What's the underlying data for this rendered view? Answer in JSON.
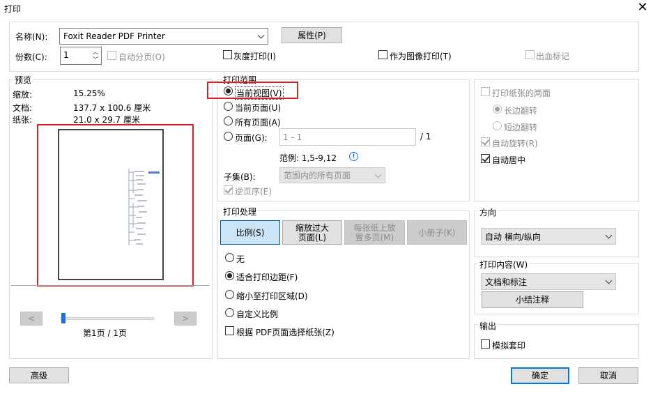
{
  "window": {
    "title": "打印"
  },
  "printer": {
    "name_label": "名称(N):",
    "name_value": "Foxit Reader PDF Printer",
    "properties_button": "属性(P)"
  },
  "copies": {
    "label": "份数(C):",
    "value": "1",
    "collate_label": "自动分页(O)"
  },
  "options": {
    "grayscale": "灰度打印(I)",
    "print_as_image": "作为图像打印(T)",
    "bleed_marks": "出血标记"
  },
  "preview": {
    "group_label": "预览",
    "scale_label": "缩放:",
    "scale_value": "15.25%",
    "document_label": "文档:",
    "document_value": "137.7 x 100.6 厘米",
    "paper_label": "纸张:",
    "paper_value": "21.0 x 29.7 厘米",
    "prev_button": "<",
    "next_button": ">",
    "page_indicator": "第1页 / 1页"
  },
  "print_range": {
    "group_label": "打印范围",
    "current_view": "当前视图(V)",
    "current_page": "当前页面(U)",
    "all_pages": "所有页面(A)",
    "pages": "页面(G):",
    "pages_placeholder": "1 - 1",
    "pages_total": "/ 1",
    "example": "范例: 1,5-9,12",
    "subset_label": "子集(B):",
    "subset_value": "范围内的所有页面",
    "reverse": "逆页序(E)"
  },
  "print_handling": {
    "group_label": "打印处理",
    "tabs": [
      "比例(S)",
      "缩放过大\n页面(L)",
      "每张纸上放\n置多页(M)",
      "小册子(K)"
    ],
    "none": "无",
    "fit_margins": "适合打印边距(F)",
    "shrink_to_area": "缩小至打印区域(D)",
    "custom_scale": "自定义比例",
    "choose_paper_by_pdf": "根据 PDF页面选择纸张(Z)"
  },
  "duplex": {
    "both_sides": "打印纸张的两面",
    "long_edge": "长边翻转",
    "short_edge": "短边翻转",
    "auto_rotate": "自动旋转(R)",
    "auto_center": "自动居中"
  },
  "orientation": {
    "group_label": "方向",
    "value": "自动 横向/纵向"
  },
  "content": {
    "group_label": "打印内容(W)",
    "value": "文档和标注",
    "summarize_button": "小结注释"
  },
  "output": {
    "group_label": "输出",
    "simulate_overprint": "模拟套印"
  },
  "footer": {
    "advanced": "高级",
    "ok": "确定",
    "cancel": "取消"
  },
  "colors": {
    "highlight_red": "#e02020",
    "accent_blue": "#0066cc",
    "info_blue": "#1e7bd6"
  }
}
